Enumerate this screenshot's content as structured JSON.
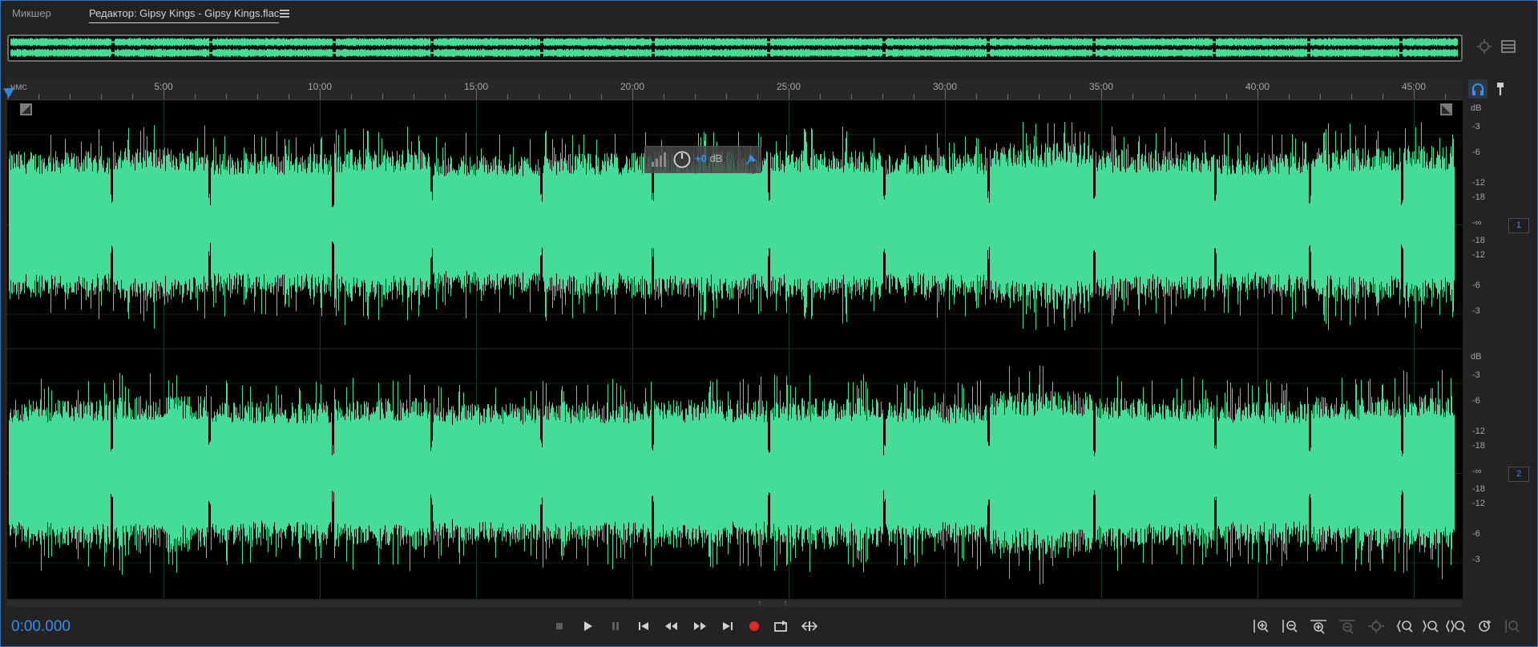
{
  "tabs": {
    "mixer": "Микшер",
    "editor": "Редактор: Gipsy Kings - Gipsy Kings.flac"
  },
  "ruler": {
    "unit": "чмс",
    "labels": [
      "5:00",
      "10:00",
      "15:00",
      "20:00",
      "25:00",
      "30:00",
      "35:00",
      "40:00",
      "45:00"
    ]
  },
  "hud": {
    "gain_value": "+0",
    "gain_unit": "dB"
  },
  "channel1": {
    "unit": "dB",
    "scale": [
      "-3",
      "-6",
      "-12",
      "-18",
      "-∞",
      "-18",
      "-12",
      "-6",
      "-3"
    ],
    "badge": "1"
  },
  "channel2": {
    "unit": "dB",
    "scale": [
      "-3",
      "-6",
      "-12",
      "-18",
      "-∞",
      "-18",
      "-12",
      "-6",
      "-3"
    ],
    "badge": "2"
  },
  "transport": {
    "time": "0:00.000"
  },
  "colors": {
    "waveform": "#44dc96",
    "accent": "#3a8ef0",
    "record": "#e0282a",
    "background": "#232323"
  },
  "icons": {
    "transport": [
      "stop-icon",
      "play-icon",
      "pause-icon",
      "skip-to-start-icon",
      "rewind-icon",
      "fast-forward-icon",
      "skip-to-end-icon",
      "record-icon",
      "loop-playback-icon",
      "skip-selection-icon"
    ],
    "zoom": [
      "zoom-in-amplitude-icon",
      "zoom-out-amplitude-icon",
      "zoom-in-time-icon",
      "zoom-out-full-icon",
      "zoom-selection-icon",
      "zoom-in-point-icon",
      "zoom-out-point-icon",
      "zoom-both-icon",
      "zoom-reset-icon",
      "zoom-full-icon"
    ]
  }
}
